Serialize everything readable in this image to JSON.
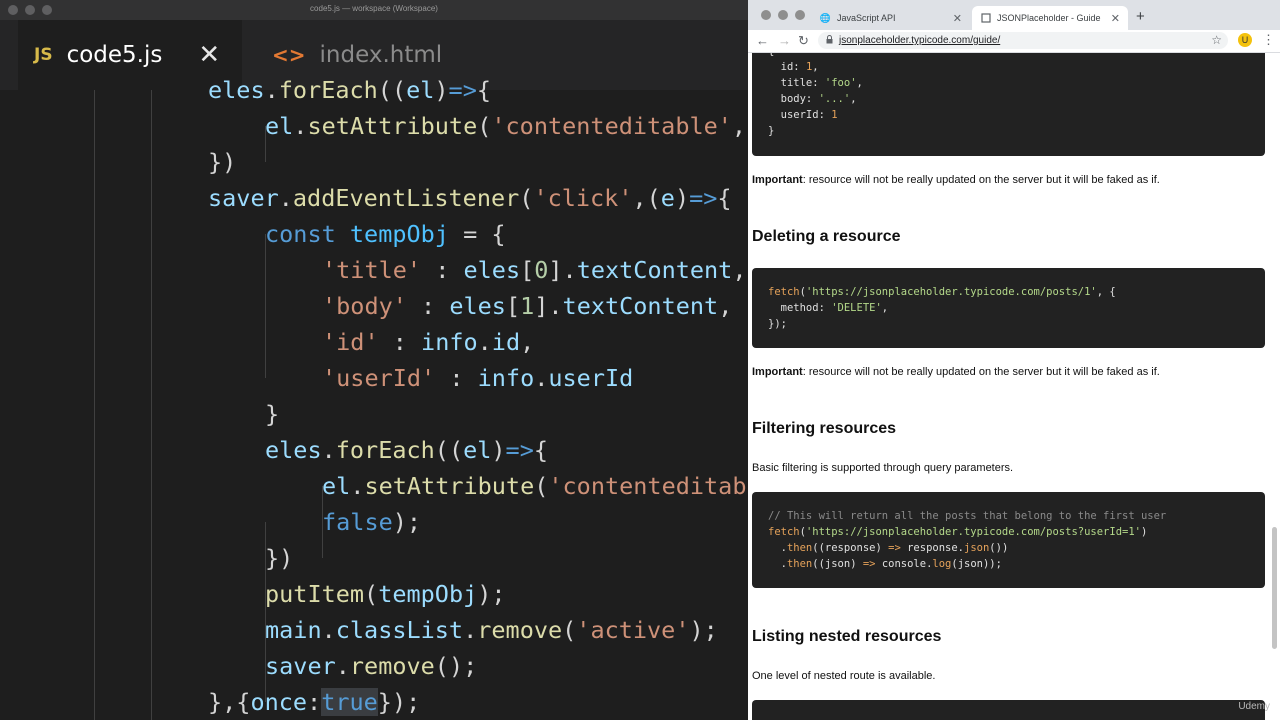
{
  "editor": {
    "window_title": "code5.js — workspace (Workspace)",
    "tabs": [
      {
        "icon": "JS",
        "label": "code5.js",
        "close": "✕"
      },
      {
        "icon": "<>",
        "label": "index.html"
      }
    ],
    "lines": [
      {
        "indent": 0,
        "tokens": [
          [
            "vr",
            "eles"
          ],
          [
            "pl",
            "."
          ],
          [
            "fn",
            "forEach"
          ],
          [
            "pl",
            "(("
          ],
          [
            "vr",
            "el"
          ],
          [
            "pl",
            ")"
          ],
          [
            "kw",
            "=>"
          ],
          [
            "pl",
            "{"
          ]
        ]
      },
      {
        "indent": 1,
        "tokens": [
          [
            "vr",
            "el"
          ],
          [
            "pl",
            "."
          ],
          [
            "fn",
            "setAttribute"
          ],
          [
            "pl",
            "("
          ],
          [
            "st",
            "'contenteditable'"
          ],
          [
            "pl",
            ","
          ]
        ]
      },
      {
        "indent": 0,
        "tokens": [
          [
            "pl",
            "})"
          ]
        ]
      },
      {
        "indent": 0,
        "tokens": [
          [
            "vr",
            "saver"
          ],
          [
            "pl",
            "."
          ],
          [
            "fn",
            "addEventListener"
          ],
          [
            "pl",
            "("
          ],
          [
            "st",
            "'click'"
          ],
          [
            "pl",
            ",("
          ],
          [
            "vr",
            "e"
          ],
          [
            "pl",
            ")"
          ],
          [
            "kw",
            "=>"
          ],
          [
            "pl",
            "{"
          ]
        ]
      },
      {
        "indent": 1,
        "tokens": [
          [
            "kw",
            "const"
          ],
          [
            "pl",
            " "
          ],
          [
            "cn",
            "tempObj"
          ],
          [
            "pl",
            " = {"
          ]
        ]
      },
      {
        "indent": 2,
        "tokens": [
          [
            "st",
            "'title'"
          ],
          [
            "pl",
            " : "
          ],
          [
            "vr",
            "eles"
          ],
          [
            "pl",
            "["
          ],
          [
            "nm",
            "0"
          ],
          [
            "pl",
            "]."
          ],
          [
            "vr",
            "textContent"
          ],
          [
            "pl",
            ","
          ]
        ]
      },
      {
        "indent": 2,
        "tokens": [
          [
            "st",
            "'body'"
          ],
          [
            "pl",
            " : "
          ],
          [
            "vr",
            "eles"
          ],
          [
            "pl",
            "["
          ],
          [
            "nm",
            "1"
          ],
          [
            "pl",
            "]."
          ],
          [
            "vr",
            "textContent"
          ],
          [
            "pl",
            ","
          ]
        ]
      },
      {
        "indent": 2,
        "tokens": [
          [
            "st",
            "'id'"
          ],
          [
            "pl",
            " : "
          ],
          [
            "vr",
            "info"
          ],
          [
            "pl",
            "."
          ],
          [
            "vr",
            "id"
          ],
          [
            "pl",
            ","
          ]
        ]
      },
      {
        "indent": 2,
        "tokens": [
          [
            "st",
            "'userId'"
          ],
          [
            "pl",
            " : "
          ],
          [
            "vr",
            "info"
          ],
          [
            "pl",
            "."
          ],
          [
            "vr",
            "userId"
          ]
        ]
      },
      {
        "indent": 1,
        "tokens": [
          [
            "pl",
            "}"
          ]
        ]
      },
      {
        "indent": 1,
        "tokens": [
          [
            "vr",
            "eles"
          ],
          [
            "pl",
            "."
          ],
          [
            "fn",
            "forEach"
          ],
          [
            "pl",
            "(("
          ],
          [
            "vr",
            "el"
          ],
          [
            "pl",
            ")"
          ],
          [
            "kw",
            "=>"
          ],
          [
            "pl",
            "{"
          ]
        ]
      },
      {
        "indent": 2,
        "tokens": [
          [
            "vr",
            "el"
          ],
          [
            "pl",
            "."
          ],
          [
            "fn",
            "setAttribute"
          ],
          [
            "pl",
            "("
          ],
          [
            "st",
            "'contenteditab"
          ]
        ]
      },
      {
        "indent": 2,
        "tokens": [
          [
            "bl",
            "false"
          ],
          [
            "pl",
            ");"
          ]
        ]
      },
      {
        "indent": 1,
        "tokens": [
          [
            "pl",
            "})"
          ]
        ]
      },
      {
        "indent": 1,
        "tokens": [
          [
            "fn",
            "putItem"
          ],
          [
            "pl",
            "("
          ],
          [
            "vr",
            "tempObj"
          ],
          [
            "pl",
            ");"
          ]
        ]
      },
      {
        "indent": 1,
        "tokens": [
          [
            "vr",
            "main"
          ],
          [
            "pl",
            "."
          ],
          [
            "vr",
            "classList"
          ],
          [
            "pl",
            "."
          ],
          [
            "fn",
            "remove"
          ],
          [
            "pl",
            "("
          ],
          [
            "st",
            "'active'"
          ],
          [
            "pl",
            ");"
          ]
        ]
      },
      {
        "indent": 1,
        "tokens": [
          [
            "vr",
            "saver"
          ],
          [
            "pl",
            "."
          ],
          [
            "fn",
            "remove"
          ],
          [
            "pl",
            "();"
          ]
        ]
      },
      {
        "indent": 0,
        "tokens": [
          [
            "pl",
            "},{"
          ],
          [
            "vr",
            "once"
          ],
          [
            "pl",
            ":"
          ],
          [
            "bl",
            "true",
            "sel"
          ],
          [
            "pl",
            "});"
          ]
        ]
      }
    ]
  },
  "browser": {
    "tabs": [
      {
        "icon": "globe-icon",
        "title": "JavaScript API"
      },
      {
        "icon": "page-icon",
        "title": "JSONPlaceholder - Guide"
      }
    ],
    "new_tab": "+",
    "close_tab": "✕",
    "url": "jsonplaceholder.typicode.com/guide/",
    "extension_label": "U",
    "code_block_1": [
      "{",
      "  id: 1,",
      "  title: 'foo',",
      "  body: '...',",
      "  userId: 1",
      "}"
    ],
    "important_label": "Important",
    "important_text": ": resource will not be really updated on the server but it will be faked as if.",
    "deleting_heading": "Deleting a resource",
    "code_block_2": [
      "fetch('https://jsonplaceholder.typicode.com/posts/1', {",
      "  method: 'DELETE',",
      "});"
    ],
    "filtering_heading": "Filtering resources",
    "filtering_text": "Basic filtering is supported through query parameters.",
    "code_block_3": [
      "// This will return all the posts that belong to the first user",
      "fetch('https://jsonplaceholder.typicode.com/posts?userId=1')",
      "  .then((response) => response.json())",
      "  .then((json) => console.log(json));"
    ],
    "nested_heading": "Listing nested resources",
    "nested_text": "One level of nested route is available.",
    "watermark": "Udemy"
  }
}
